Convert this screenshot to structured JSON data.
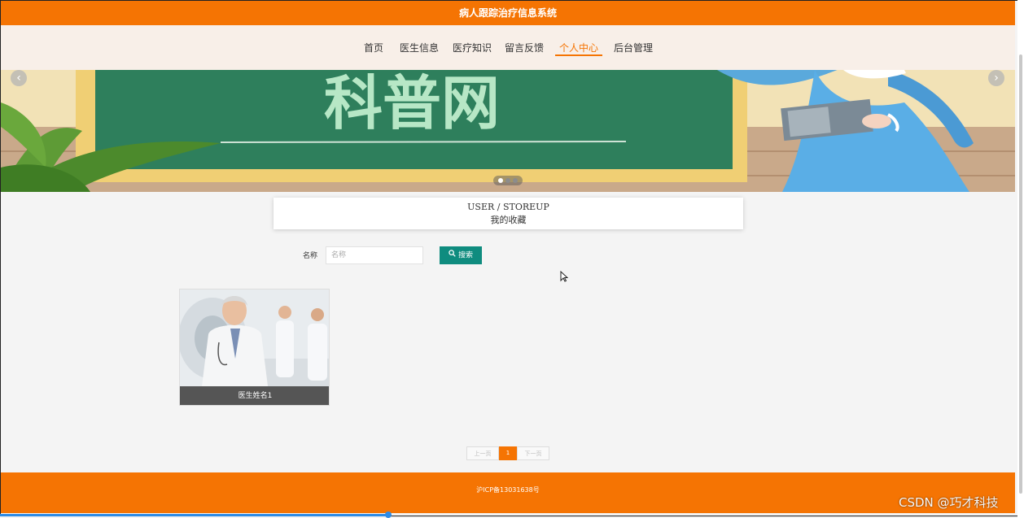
{
  "app_title": "病人跟踪治疗信息系统",
  "nav": {
    "items": [
      {
        "label": "首页",
        "active": false
      },
      {
        "label": "医生信息",
        "active": false
      },
      {
        "label": "医疗知识",
        "active": false
      },
      {
        "label": "留言反馈",
        "active": false
      },
      {
        "label": "个人中心",
        "active": true
      },
      {
        "label": "后台管理",
        "active": false
      }
    ]
  },
  "banner": {
    "headline": "科普网",
    "prev_icon": "chevron-left-icon",
    "next_icon": "chevron-right-icon",
    "slide_count": 3,
    "active_slide": 1
  },
  "section": {
    "title_en": "USER / STOREUP",
    "title_cn": "我的收藏"
  },
  "search": {
    "label": "名称",
    "placeholder": "名称",
    "value": "",
    "button_label": "搜索",
    "button_icon": "search-icon"
  },
  "favorites": [
    {
      "title": "医生姓名1"
    }
  ],
  "pagination": {
    "prev_label": "上一页",
    "current_page": "1",
    "next_label": "下一页"
  },
  "footer": {
    "icp": "沪ICP备13031638号"
  },
  "watermark": "CSDN @巧才科技",
  "colors": {
    "primary": "#f57403",
    "nav_bg": "#f8efe8",
    "search_button": "#0f8c7f",
    "card_caption": "#555555"
  }
}
